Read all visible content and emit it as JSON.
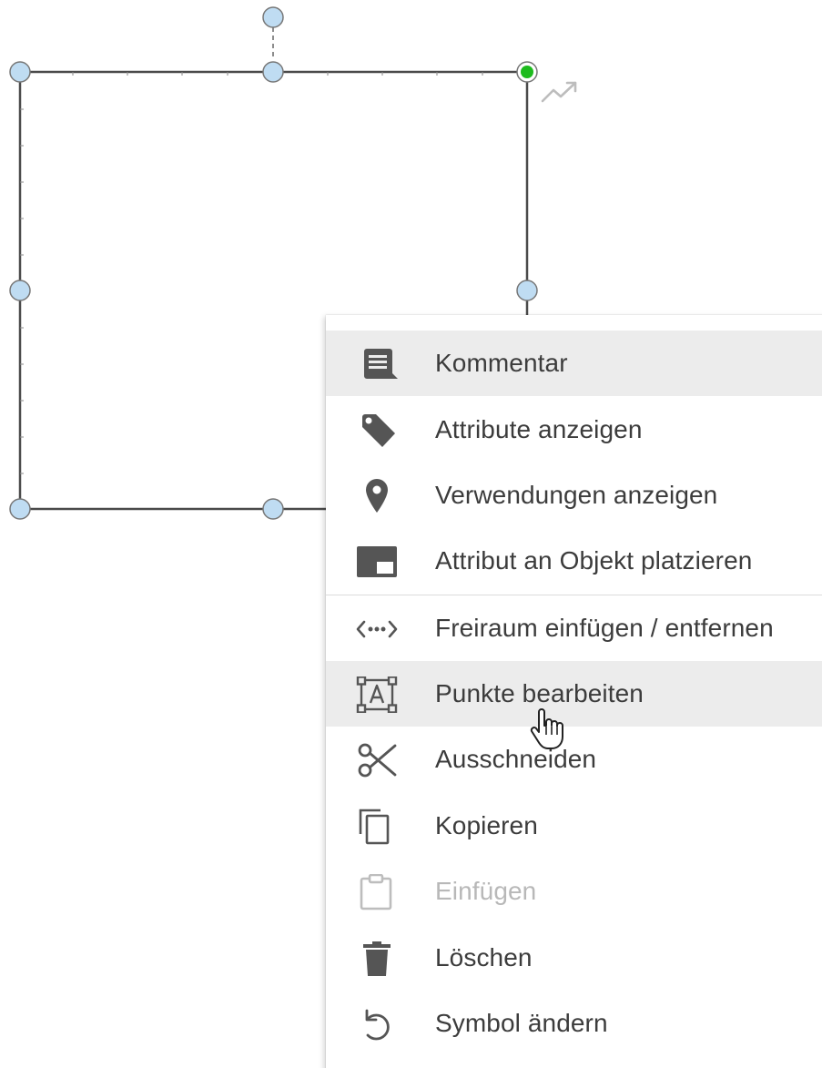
{
  "shape": {
    "colors": {
      "outline": "#4a4a4a",
      "handle_fill": "#bfdcf2",
      "handle_stroke": "#777777",
      "connection_handle_fill": "#1dbb1d",
      "hint_icon": "#bdbdbd"
    },
    "hint_icon_name": "trending-up-icon"
  },
  "context_menu": {
    "items": [
      {
        "label": "Kommentar",
        "icon": "comment-icon",
        "state": "hover"
      },
      {
        "label": "Attribute anzeigen",
        "icon": "tag-icon",
        "state": "normal"
      },
      {
        "label": "Verwendungen anzeigen",
        "icon": "location-pin-icon",
        "state": "normal"
      },
      {
        "label": "Attribut an Objekt platzieren",
        "icon": "attribute-placement-icon",
        "state": "normal"
      },
      {
        "label": "Freiraum einfügen / entfernen",
        "icon": "spacing-arrows-icon",
        "state": "normal"
      },
      {
        "label": "Punkte bearbeiten",
        "icon": "edit-points-icon",
        "state": "hover"
      },
      {
        "label": "Ausschneiden",
        "icon": "scissors-icon",
        "state": "normal"
      },
      {
        "label": "Kopieren",
        "icon": "copy-icon",
        "state": "normal"
      },
      {
        "label": "Einfügen",
        "icon": "clipboard-icon",
        "state": "disabled"
      },
      {
        "label": "Löschen",
        "icon": "trash-icon",
        "state": "normal"
      },
      {
        "label": "Symbol ändern",
        "icon": "undo-rotate-icon",
        "state": "normal"
      }
    ],
    "colors": {
      "text": "#3c3c3c",
      "text_disabled": "#b8b8b8",
      "icon": "#555555",
      "icon_disabled": "#bdbdbd",
      "hover_bg": "#ececec",
      "divider": "#dcdcdc"
    }
  }
}
